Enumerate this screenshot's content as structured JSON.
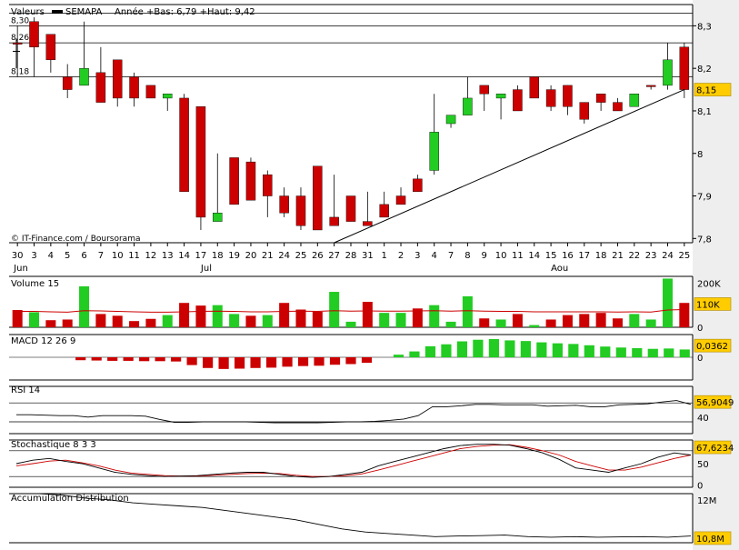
{
  "header": {
    "series_label": "Valeurs",
    "legend_name": "SEMAPA",
    "year_range": "Année +Bas: 6,79 +Haut: 9,42"
  },
  "credit": "© IT-Finance.com / Boursorama",
  "colors": {
    "up": "#22cc22",
    "down": "#cc0000",
    "avg": "#cc0000",
    "tag": "#ffcc00",
    "grid": "#000000",
    "bg_strip": "#eeeeee"
  },
  "chart_data": [
    {
      "panel": "price",
      "type": "candlestick",
      "ylim": [
        7.79,
        8.35
      ],
      "yticks": [
        "7,8",
        "7,9",
        "8",
        "8,1",
        "8,2",
        "8,3"
      ],
      "ytick_values": [
        7.8,
        7.9,
        8.0,
        8.1,
        8.2,
        8.3
      ],
      "last_value": "8,15",
      "left_levels": [
        "8,30",
        "8,26",
        "8,18"
      ],
      "level_values": [
        8.33,
        8.3,
        8.26,
        8.18
      ],
      "x_labels": [
        "30",
        "3",
        "4",
        "5",
        "6",
        "7",
        "10",
        "11",
        "12",
        "13",
        "14",
        "17",
        "18",
        "19",
        "20",
        "21",
        "24",
        "25",
        "26",
        "27",
        "28",
        "31",
        "1",
        "2",
        "3",
        "4",
        "7",
        "8",
        "9",
        "10",
        "11",
        "14",
        "15",
        "16",
        "17",
        "18",
        "21",
        "22",
        "23",
        "24",
        "25"
      ],
      "months": [
        "Jun",
        "Jul",
        "Aou"
      ],
      "month_index": [
        0,
        11,
        32
      ],
      "trendline": {
        "from_index": 19,
        "from_value": 7.79,
        "to_index": 40,
        "to_value": 8.15
      },
      "candles": [
        {
          "o": 8.26,
          "h": 8.3,
          "l": 8.18,
          "c": 8.26
        },
        {
          "o": 8.31,
          "h": 8.32,
          "l": 8.18,
          "c": 8.25
        },
        {
          "o": 8.28,
          "h": 8.28,
          "l": 8.19,
          "c": 8.22
        },
        {
          "o": 8.18,
          "h": 8.21,
          "l": 8.13,
          "c": 8.15
        },
        {
          "o": 8.16,
          "h": 8.31,
          "l": 8.16,
          "c": 8.2
        },
        {
          "o": 8.19,
          "h": 8.25,
          "l": 8.12,
          "c": 8.12
        },
        {
          "o": 8.22,
          "h": 8.22,
          "l": 8.11,
          "c": 8.13
        },
        {
          "o": 8.18,
          "h": 8.19,
          "l": 8.11,
          "c": 8.13
        },
        {
          "o": 8.16,
          "h": 8.16,
          "l": 8.13,
          "c": 8.13
        },
        {
          "o": 8.13,
          "h": 8.14,
          "l": 8.1,
          "c": 8.14
        },
        {
          "o": 8.13,
          "h": 8.14,
          "l": 7.91,
          "c": 7.91
        },
        {
          "o": 8.11,
          "h": 8.11,
          "l": 7.82,
          "c": 7.85
        },
        {
          "o": 7.84,
          "h": 8.0,
          "l": 7.84,
          "c": 7.86
        },
        {
          "o": 7.99,
          "h": 7.99,
          "l": 7.88,
          "c": 7.88
        },
        {
          "o": 7.98,
          "h": 7.99,
          "l": 7.89,
          "c": 7.89
        },
        {
          "o": 7.95,
          "h": 7.96,
          "l": 7.85,
          "c": 7.9
        },
        {
          "o": 7.9,
          "h": 7.92,
          "l": 7.85,
          "c": 7.86
        },
        {
          "o": 7.9,
          "h": 7.92,
          "l": 7.82,
          "c": 7.83
        },
        {
          "o": 7.97,
          "h": 7.97,
          "l": 7.82,
          "c": 7.82
        },
        {
          "o": 7.85,
          "h": 7.95,
          "l": 7.83,
          "c": 7.83
        },
        {
          "o": 7.9,
          "h": 7.9,
          "l": 7.84,
          "c": 7.84
        },
        {
          "o": 7.84,
          "h": 7.91,
          "l": 7.83,
          "c": 7.83
        },
        {
          "o": 7.88,
          "h": 7.91,
          "l": 7.85,
          "c": 7.85
        },
        {
          "o": 7.9,
          "h": 7.92,
          "l": 7.88,
          "c": 7.88
        },
        {
          "o": 7.94,
          "h": 7.95,
          "l": 7.91,
          "c": 7.91
        },
        {
          "o": 7.96,
          "h": 8.14,
          "l": 7.95,
          "c": 8.05
        },
        {
          "o": 8.07,
          "h": 8.09,
          "l": 8.06,
          "c": 8.09
        },
        {
          "o": 8.09,
          "h": 8.18,
          "l": 8.09,
          "c": 8.13
        },
        {
          "o": 8.16,
          "h": 8.16,
          "l": 8.1,
          "c": 8.14
        },
        {
          "o": 8.13,
          "h": 8.14,
          "l": 8.08,
          "c": 8.14
        },
        {
          "o": 8.15,
          "h": 8.16,
          "l": 8.1,
          "c": 8.1
        },
        {
          "o": 8.18,
          "h": 8.18,
          "l": 8.13,
          "c": 8.13
        },
        {
          "o": 8.15,
          "h": 8.16,
          "l": 8.1,
          "c": 8.11
        },
        {
          "o": 8.16,
          "h": 8.16,
          "l": 8.09,
          "c": 8.11
        },
        {
          "o": 8.12,
          "h": 8.12,
          "l": 8.07,
          "c": 8.08
        },
        {
          "o": 8.14,
          "h": 8.14,
          "l": 8.1,
          "c": 8.12
        },
        {
          "o": 8.12,
          "h": 8.13,
          "l": 8.1,
          "c": 8.1
        },
        {
          "o": 8.11,
          "h": 8.14,
          "l": 8.11,
          "c": 8.14
        },
        {
          "o": 8.16,
          "h": 8.16,
          "l": 8.15,
          "c": 8.16
        },
        {
          "o": 8.16,
          "h": 8.26,
          "l": 8.15,
          "c": 8.22
        },
        {
          "o": 8.25,
          "h": 8.26,
          "l": 8.13,
          "c": 8.15
        }
      ]
    },
    {
      "panel": "volume",
      "type": "bar",
      "title": "Volume 15",
      "ylim": [
        0,
        230
      ],
      "yticks": [
        "0",
        "100K",
        "200K"
      ],
      "last_value": "110K",
      "values": [
        78,
        68,
        32,
        35,
        185,
        60,
        52,
        28,
        38,
        55,
        110,
        98,
        100,
        60,
        52,
        55,
        110,
        80,
        70,
        160,
        25,
        115,
        65,
        65,
        85,
        100,
        25,
        140,
        40,
        35,
        60,
        10,
        35,
        55,
        60,
        65,
        40,
        60,
        35,
        220,
        110
      ],
      "dir": [
        "d",
        "u",
        "d",
        "d",
        "u",
        "d",
        "d",
        "d",
        "d",
        "u",
        "d",
        "d",
        "u",
        "u",
        "d",
        "u",
        "d",
        "d",
        "d",
        "u",
        "u",
        "d",
        "u",
        "u",
        "d",
        "u",
        "u",
        "u",
        "d",
        "u",
        "d",
        "u",
        "d",
        "d",
        "d",
        "d",
        "d",
        "u",
        "u",
        "u",
        "d"
      ],
      "avg": [
        72,
        72,
        70,
        68,
        75,
        74,
        72,
        70,
        68,
        68,
        70,
        72,
        73,
        72,
        70,
        70,
        72,
        73,
        72,
        75,
        73,
        74,
        73,
        73,
        74,
        75,
        73,
        75,
        73,
        72,
        72,
        70,
        70,
        70,
        70,
        70,
        69,
        70,
        69,
        78,
        80
      ]
    },
    {
      "panel": "macd",
      "type": "bar",
      "title": "MACD 12 26 9",
      "ylim": [
        -0.07,
        0.07
      ],
      "yticks": [
        "0"
      ],
      "last_value": "0,0362",
      "values": [
        0,
        0,
        0,
        0,
        -0.009,
        -0.01,
        -0.011,
        -0.011,
        -0.012,
        -0.012,
        -0.013,
        -0.024,
        -0.033,
        -0.036,
        -0.035,
        -0.033,
        -0.032,
        -0.029,
        -0.027,
        -0.026,
        -0.023,
        -0.021,
        -0.017,
        0,
        0.008,
        0.018,
        0.034,
        0.04,
        0.049,
        0.054,
        0.056,
        0.052,
        0.05,
        0.046,
        0.043,
        0.041,
        0.037,
        0.033,
        0.03,
        0.028,
        0.026,
        0.027,
        0.024
      ]
    },
    {
      "panel": "rsi",
      "type": "line",
      "title": "RSI 14",
      "ylim": [
        5,
        105
      ],
      "yticks": [
        "40"
      ],
      "levels": [
        30,
        70
      ],
      "last_value": "56,9049",
      "values": [
        45,
        45,
        44,
        43,
        43,
        40,
        43,
        43,
        43,
        42,
        35,
        29,
        29,
        30,
        30,
        30,
        30,
        29,
        28,
        28,
        28,
        28,
        29,
        30,
        30,
        31,
        33,
        36,
        43,
        62,
        62,
        64,
        67,
        67,
        66,
        66,
        66,
        63,
        64,
        65,
        62,
        62,
        66,
        67,
        68,
        72,
        75,
        67
      ]
    },
    {
      "panel": "stochastic",
      "type": "line",
      "title": "Stochastique 8 3 3",
      "ylim": [
        -5,
        105
      ],
      "yticks": [
        "0",
        "50"
      ],
      "levels": [
        20,
        80
      ],
      "last_value": "67,6234",
      "k": [
        50,
        58,
        62,
        55,
        50,
        40,
        30,
        25,
        22,
        20,
        21,
        22,
        25,
        28,
        30,
        30,
        25,
        20,
        18,
        20,
        25,
        30,
        45,
        55,
        65,
        75,
        85,
        92,
        95,
        95,
        93,
        85,
        75,
        60,
        40,
        35,
        30,
        40,
        50,
        65,
        75,
        70
      ],
      "d": [
        45,
        50,
        56,
        58,
        52,
        45,
        35,
        28,
        25,
        22,
        21,
        21,
        23,
        25,
        27,
        28,
        27,
        23,
        20,
        20,
        22,
        26,
        35,
        45,
        55,
        65,
        75,
        85,
        90,
        93,
        94,
        88,
        80,
        70,
        55,
        45,
        35,
        35,
        42,
        52,
        62,
        70
      ]
    },
    {
      "panel": "accumulation",
      "type": "line",
      "title": "Accumulation Distribution",
      "ylim": [
        10.6,
        12.2
      ],
      "yticks": [
        "12M"
      ],
      "last_value": "10,8M",
      "values": [
        12.2,
        12.2,
        12.15,
        12.05,
        12.0,
        11.9,
        11.85,
        11.8,
        11.75,
        11.65,
        11.55,
        11.45,
        11.35,
        11.2,
        11.05,
        10.95,
        10.9,
        10.85,
        10.8,
        10.82,
        10.83,
        10.85,
        10.8,
        10.78,
        10.8,
        10.78,
        10.79,
        10.8,
        10.78,
        10.82
      ]
    }
  ]
}
